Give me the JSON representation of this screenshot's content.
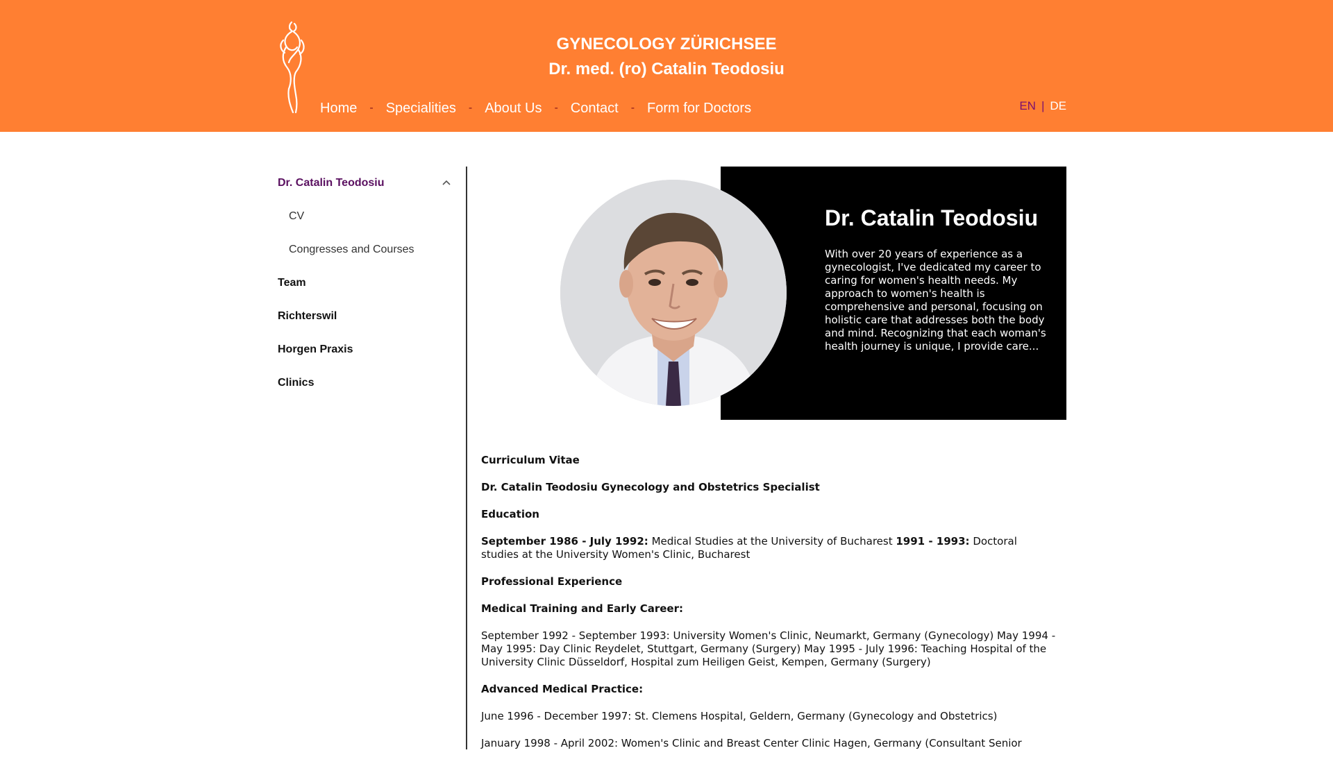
{
  "header": {
    "title_line1": "GYNECOLOGY ZÜRICHSEE",
    "title_line2": "Dr. med. (ro) Catalin Teodosiu",
    "background_color": "#ff7f32",
    "logo_icon": "female-silhouette-logo-icon",
    "nav": [
      {
        "label": "Home"
      },
      {
        "label": "Specialities"
      },
      {
        "label": "About Us"
      },
      {
        "label": "Contact"
      },
      {
        "label": "Form for Doctors"
      }
    ],
    "nav_separator": "-",
    "lang": {
      "active": "EN",
      "divider": "|",
      "other": "DE"
    }
  },
  "sidebar": {
    "items": [
      {
        "label": "Dr. Catalin Teodosiu",
        "expanded": true,
        "icon": "chevron-up-icon",
        "children": [
          {
            "label": "CV"
          },
          {
            "label": "Congresses and Courses"
          }
        ]
      },
      {
        "label": "Team"
      },
      {
        "label": "Richterswil"
      },
      {
        "label": "Horgen Praxis"
      },
      {
        "label": "Clinics"
      }
    ]
  },
  "hero": {
    "name": "Dr. Catalin Teodosiu",
    "text": "With over 20 years of experience as a gynecologist, I've dedicated my career to caring for women's health needs. My approach to women's health is comprehensive and personal, focusing on holistic care that addresses both the body and mind. Recognizing that each woman's health journey is unique, I provide care..."
  },
  "cv": {
    "heading": "Curriculum Vitae",
    "subtitle": "Dr. Catalin Teodosiu Gynecology and Obstetrics Specialist",
    "education_heading": "Education",
    "education": {
      "date1": "September 1986 - July 1992:",
      "text1": " Medical Studies at the University of Bucharest ",
      "date2": "1991 - 1993:",
      "text2": " Doctoral studies at the University Women's Clinic, Bucharest"
    },
    "experience_heading": "Professional Experience",
    "training_heading": "Medical Training and Early Career:",
    "training_text": "September 1992 - September 1993: University Women's Clinic, Neumarkt, Germany (Gynecology) May 1994 - May 1995: Day Clinic Reydelet, Stuttgart, Germany (Surgery) May 1995 - July 1996: Teaching Hospital of the University Clinic Düsseldorf, Hospital zum Heiligen Geist, Kempen, Germany (Surgery)",
    "advanced_heading": "Advanced Medical Practice:",
    "advanced_text1": "June 1996 - December 1997: St. Clemens Hospital, Geldern, Germany (Gynecology and Obstetrics)",
    "advanced_text2": "January 1998 - April 2002: Women's Clinic and Breast Center Clinic Hagen, Germany (Consultant Senior"
  }
}
